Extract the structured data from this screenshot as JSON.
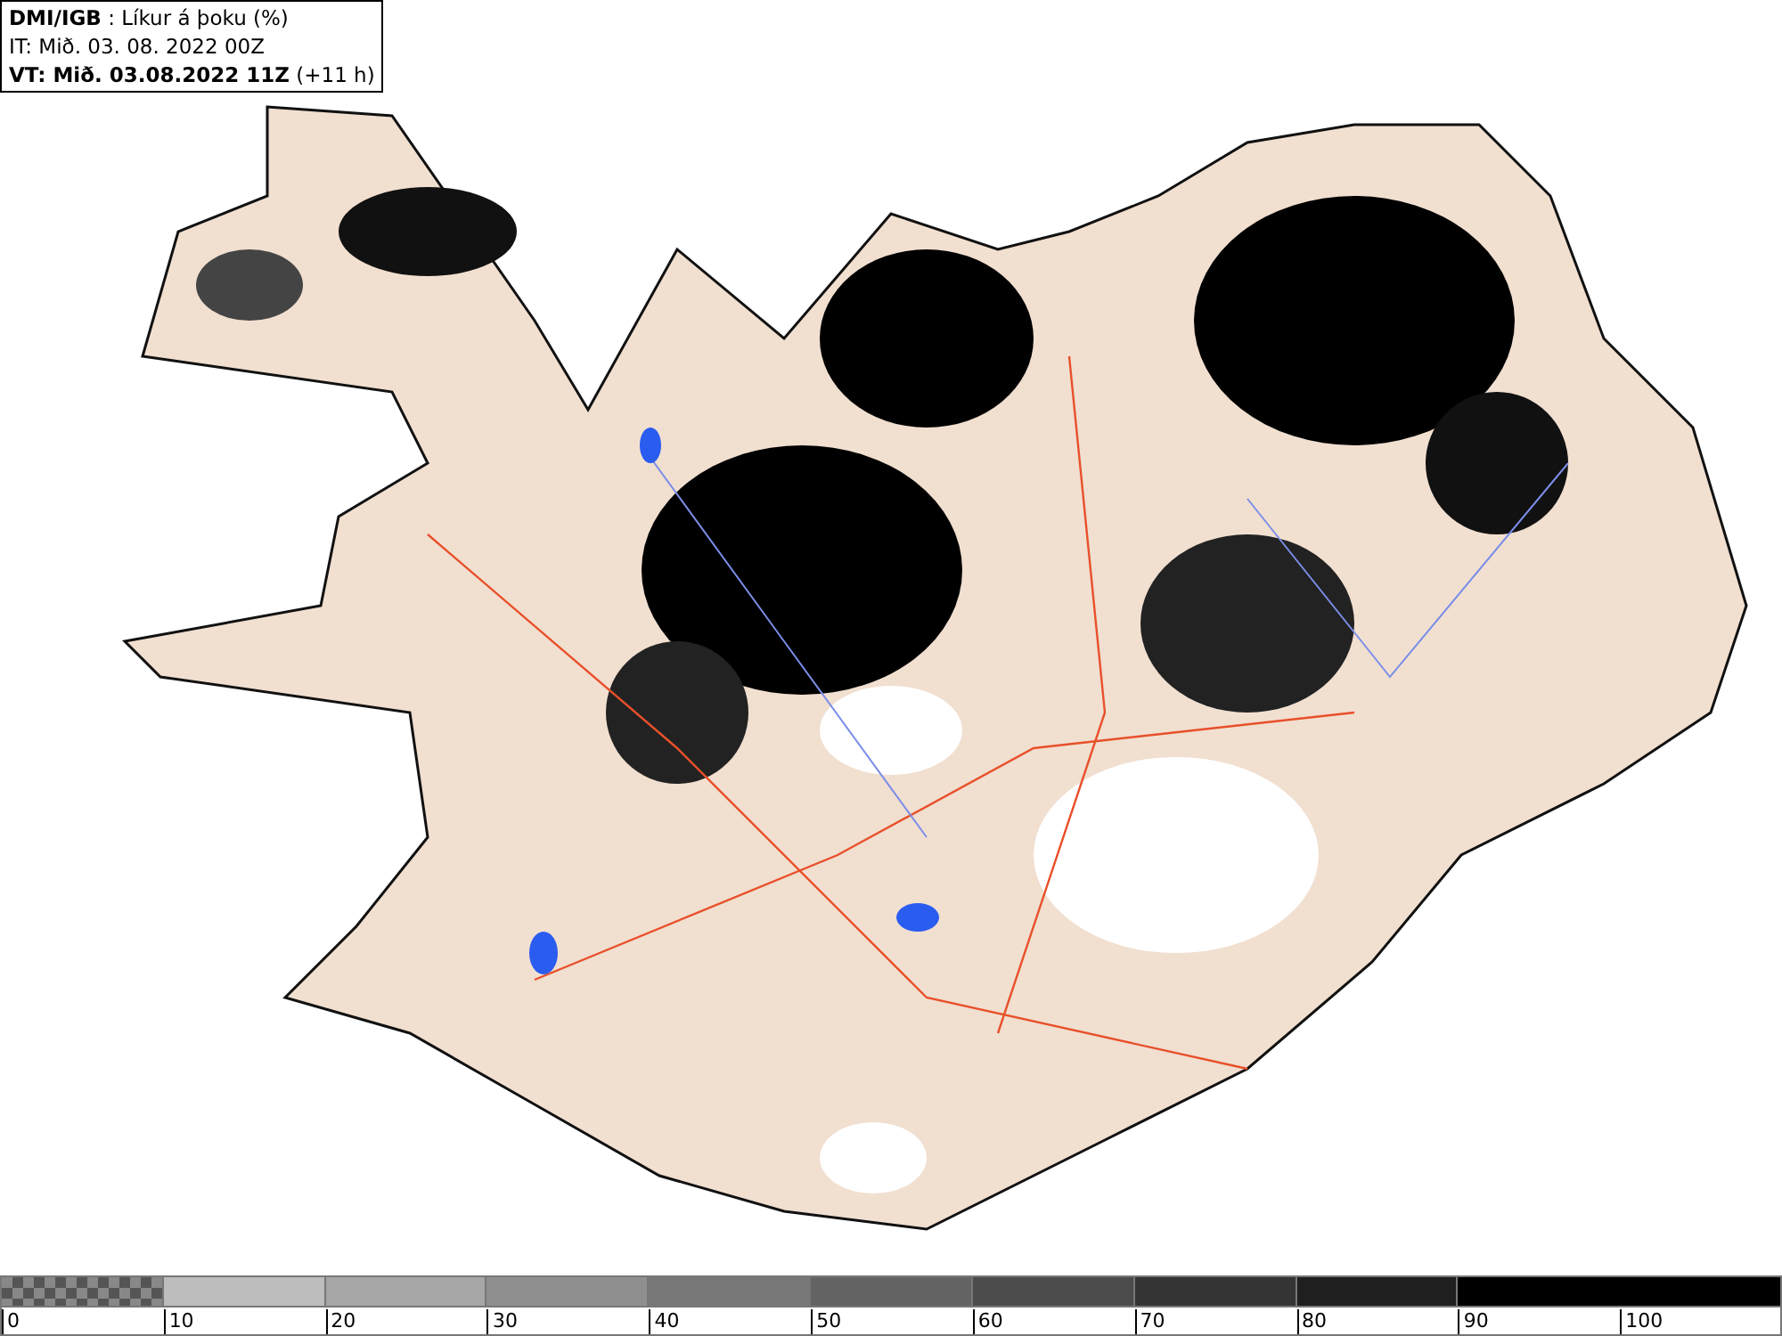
{
  "header": {
    "source": "DMI/IGB",
    "title": " : Líkur á þoku (%)",
    "initial_time": "IT: Mið. 03. 08. 2022 00Z",
    "valid_time": "VT: Mið. 03.08.2022 11Z",
    "offset": " (+11 h)"
  },
  "legend": {
    "bins": [
      {
        "kind": "pattern",
        "color": "#555555"
      },
      {
        "kind": "solid",
        "color": "#bdbdbd"
      },
      {
        "kind": "solid",
        "color": "#a6a6a6"
      },
      {
        "kind": "solid",
        "color": "#8f8f8f"
      },
      {
        "kind": "solid",
        "color": "#787878"
      },
      {
        "kind": "solid",
        "color": "#636363"
      },
      {
        "kind": "solid",
        "color": "#4c4c4c"
      },
      {
        "kind": "solid",
        "color": "#353535"
      },
      {
        "kind": "solid",
        "color": "#1f1f1f"
      },
      {
        "kind": "solid",
        "color": "#000000"
      }
    ],
    "ticks": [
      "0",
      "10",
      "20",
      "30",
      "40",
      "50",
      "60",
      "70",
      "80",
      "90",
      "100"
    ]
  }
}
